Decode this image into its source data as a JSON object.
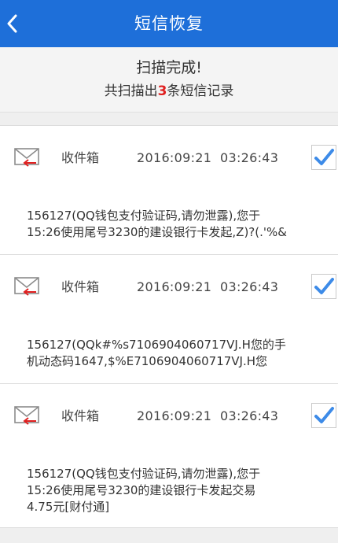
{
  "header": {
    "title": "短信恢复",
    "back_icon": "chevron-left-icon",
    "bg_color": "#1e6fd9"
  },
  "summary": {
    "title": "扫描完成!",
    "count_prefix": "共扫描出",
    "count": "3",
    "count_suffix": "条短信记录",
    "count_color": "#e02020"
  },
  "messages": [
    {
      "icon": "envelope-incoming-icon",
      "folder": "收件箱",
      "time": "2016:09:21  03:26:43",
      "checked": true,
      "body": "156127(QQ钱包支付验证码,请勿泄露),您于\n15:26使用尾号3230的建设银行卡发起,Z)?(.'%&"
    },
    {
      "icon": "envelope-incoming-icon",
      "folder": "收件箱",
      "time": "2016:09:21  03:26:43",
      "checked": true,
      "body": "156127(QQk#%s7106904060717VJ.H您的手\n机动态码1647,$%E7106904060717VJ.H您"
    },
    {
      "icon": "envelope-incoming-icon",
      "folder": "收件箱",
      "time": "2016:09:21  03:26:43",
      "checked": true,
      "body": "156127(QQ钱包支付验证码,请勿泄露),您于\n15:26使用尾号3230的建设银行卡发起交易\n4.75元[财付通]"
    }
  ]
}
